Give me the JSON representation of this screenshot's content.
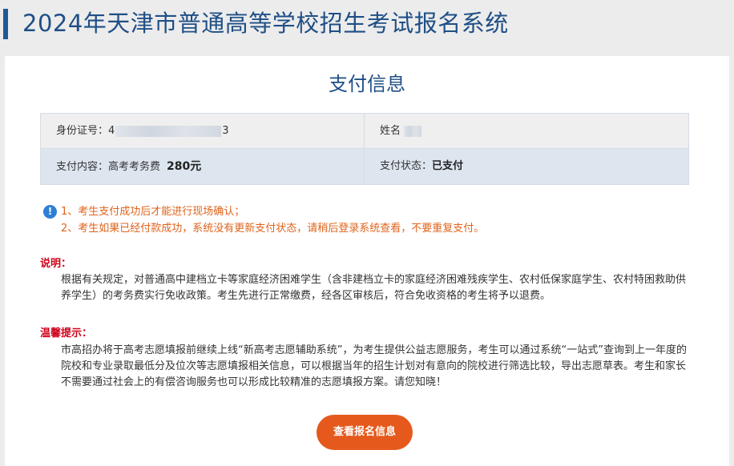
{
  "header": {
    "title": "2024年天津市普通高等学校招生考试报名系统"
  },
  "panel": {
    "title": "支付信息"
  },
  "info": {
    "id_label": "身份证号：",
    "id_prefix": "4",
    "id_suffix": "3",
    "name_label": "姓名",
    "payment_content_label": "支付内容：",
    "payment_content_value": "高考考务费",
    "payment_amount": "280元",
    "payment_status_label": "支付状态：",
    "payment_status_value": "已支付"
  },
  "notice": {
    "icon": "exclamation-icon",
    "line1": "1、考生支付成功后才能进行现场确认；",
    "line2": "2、考生如果已经付款成功，系统没有更新支付状态，请稍后登录系统查看，不要重复支付。"
  },
  "explain": {
    "heading": "说明：",
    "body": "根据有关规定，对普通高中建档立卡等家庭经济困难学生（含非建档立卡的家庭经济困难残疾学生、农村低保家庭学生、农村特困救助供养学生）的考务费实行免收政策。考生先进行正常缴费，经各区审核后，符合免收资格的考生将予以退费。"
  },
  "tips": {
    "heading": "温馨提示：",
    "body": "市高招办将于高考志愿填报前继续上线“新高考志愿辅助系统”，为考生提供公益志愿服务，考生可以通过系统“一站式”查询到上一年度的院校和专业录取最低分及位次等志愿填报相关信息，可以根据当年的招生计划对有意向的院校进行筛选比较，导出志愿草表。考生和家长不需要通过社会上的有偿咨询服务也可以形成比较精准的志愿填报方案。请您知晓！"
  },
  "actions": {
    "view_button": "查看报名信息"
  },
  "colors": {
    "brand": "#1f4f86",
    "accent": "#e55a1c",
    "warning": "#e0631c",
    "danger": "#d0021b"
  }
}
